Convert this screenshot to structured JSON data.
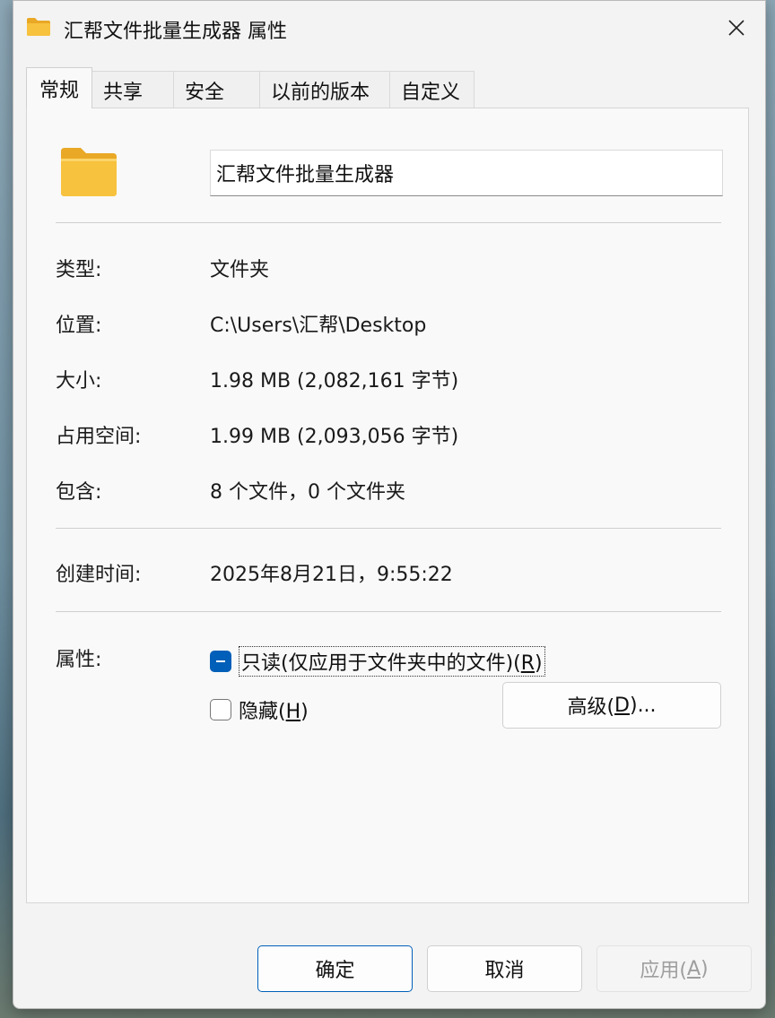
{
  "window": {
    "title": "汇帮文件批量生成器 属性"
  },
  "tabs": [
    "常规",
    "共享",
    "安全",
    "以前的版本",
    "自定义"
  ],
  "general": {
    "name": "汇帮文件批量生成器",
    "type_label": "类型:",
    "type_value": "文件夹",
    "location_label": "位置:",
    "location_value": "C:\\Users\\汇帮\\Desktop",
    "size_label": "大小:",
    "size_value": "1.98 MB (2,082,161 字节)",
    "disk_label": "占用空间:",
    "disk_value": "1.99 MB (2,093,056 字节)",
    "contains_label": "包含:",
    "contains_value": "8 个文件，0 个文件夹",
    "created_label": "创建时间:",
    "created_value": "2025年8月21日，9:55:22",
    "attributes_label": "属性:",
    "readonly": {
      "text": "只读(仅应用于文件夹中的文件)(",
      "key": "R",
      "close": ")",
      "state": "indeterminate"
    },
    "hidden": {
      "text": "隐藏(",
      "key": "H",
      "close": ")",
      "checked": false
    },
    "advanced": {
      "text": "高级(",
      "key": "D",
      "close": ")..."
    }
  },
  "buttons": {
    "ok": "确定",
    "cancel": "取消",
    "apply": {
      "text": "应用(",
      "key": "A",
      "close": ")",
      "disabled": true
    }
  },
  "colors": {
    "accent": "#005fb8",
    "folder": "#f7c23e"
  },
  "icons": {
    "title": "folder-icon",
    "close": "close-icon",
    "large": "folder-large-icon"
  }
}
